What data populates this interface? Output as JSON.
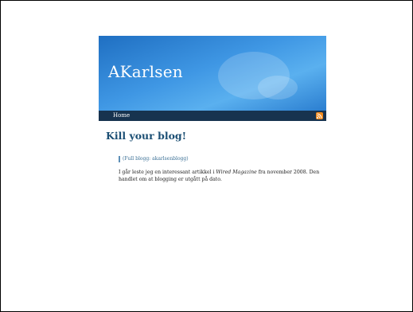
{
  "site": {
    "title": "AKarlsen"
  },
  "nav": {
    "home_label": "Home",
    "rss_icon": "rss-icon"
  },
  "post": {
    "title": "Kill your blog!",
    "fullblog_prefix": "(Full blogg: ",
    "fullblog_link": "akarlsenblogg",
    "fullblog_suffix": ")",
    "text_part1": "I går leste jeg en interessant artikkel i ",
    "text_italic": "Wired Magazine",
    "text_part2": " fra november 2008. Den handlet om at blogging er utgått på dato."
  },
  "colors": {
    "header_blue": "#3f97e4",
    "navbar": "#17334f",
    "title": "#1c4f74",
    "rss": "#f28a1c"
  }
}
